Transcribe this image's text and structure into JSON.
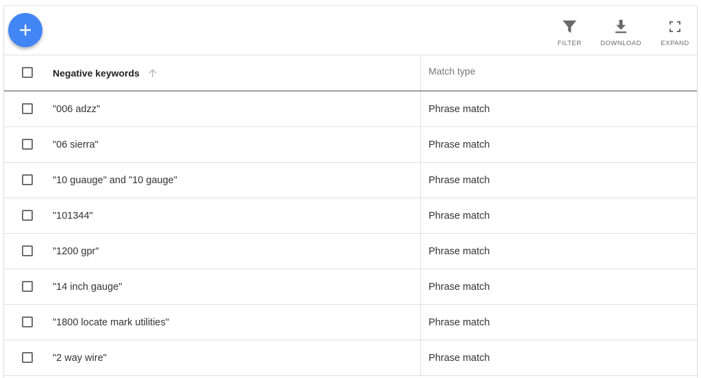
{
  "toolbar": {
    "add_button": "+",
    "filter_label": "FILTER",
    "download_label": "DOWNLOAD",
    "expand_label": "EXPAND"
  },
  "table": {
    "columns": {
      "keyword": "Negative keywords",
      "match_type": "Match type",
      "sort_direction": "ascending"
    },
    "rows": [
      {
        "keyword": "\"006 adzz\"",
        "match_type": "Phrase match"
      },
      {
        "keyword": "\"06 sierra\"",
        "match_type": "Phrase match"
      },
      {
        "keyword": "\"10 guauge\" and \"10 gauge\"",
        "match_type": "Phrase match"
      },
      {
        "keyword": "\"101344\"",
        "match_type": "Phrase match"
      },
      {
        "keyword": "\"1200 gpr\"",
        "match_type": "Phrase match"
      },
      {
        "keyword": "\"14 inch gauge\"",
        "match_type": "Phrase match"
      },
      {
        "keyword": "\"1800 locate mark utilities\"",
        "match_type": "Phrase match"
      },
      {
        "keyword": "\"2 way wire\"",
        "match_type": "Phrase match"
      }
    ]
  },
  "colors": {
    "fab": "#4285f4",
    "icon": "#6b6b6b",
    "header_border": "#9e9e9e",
    "row_border": "#e0e0e0"
  },
  "icons": {
    "add": "plus-icon",
    "filter": "funnel-icon",
    "download": "download-icon",
    "expand": "fullscreen-icon",
    "sort": "arrow-up-icon"
  }
}
